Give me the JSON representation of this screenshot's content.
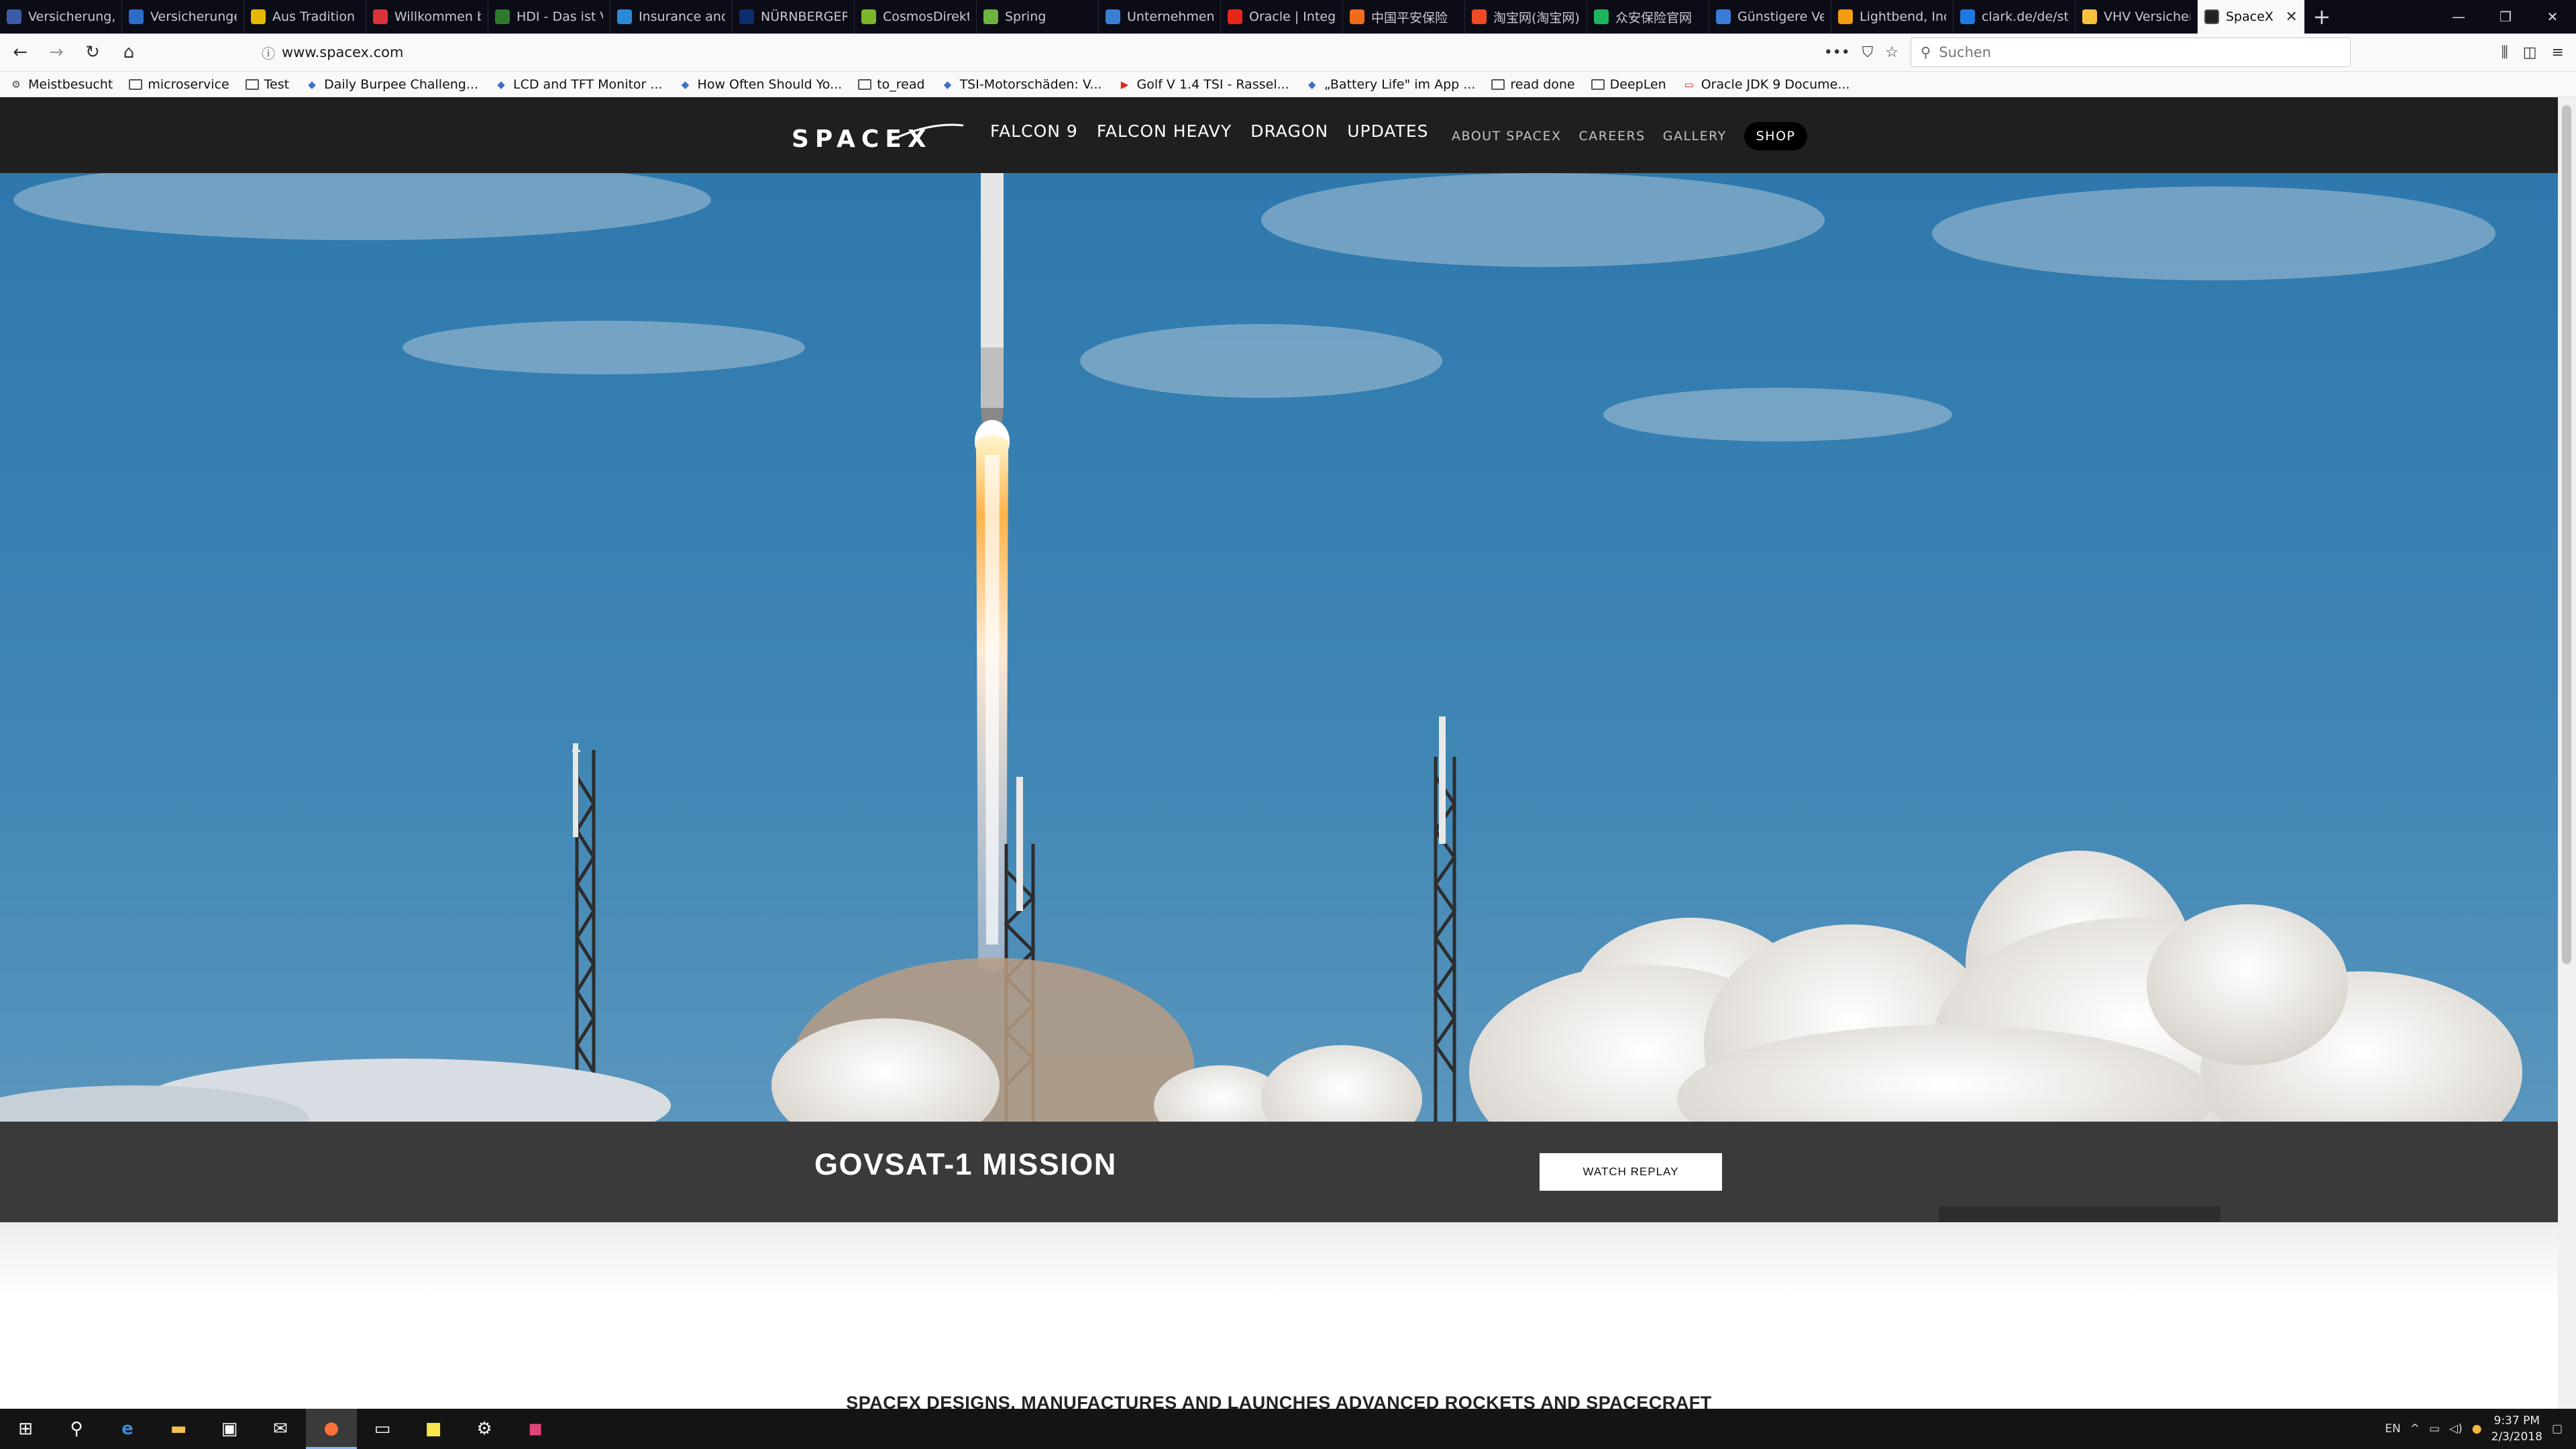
{
  "browser": {
    "tabs": [
      {
        "title": "Versicherung, V",
        "color": "#3b5ba9"
      },
      {
        "title": "Versicherungen",
        "color": "#2e6cc9"
      },
      {
        "title": "Aus Tradition g",
        "color": "#e6b800"
      },
      {
        "title": "Willkommen b",
        "color": "#d9343a"
      },
      {
        "title": "HDI - Das ist Vi",
        "color": "#2d7a2d"
      },
      {
        "title": "Insurance and",
        "color": "#2b8ad8"
      },
      {
        "title": "NÜRNBERGER",
        "color": "#0d2d6e"
      },
      {
        "title": "CosmosDirekt",
        "color": "#7bb62a"
      },
      {
        "title": "Spring",
        "color": "#6db33f"
      },
      {
        "title": "Unternehmens",
        "color": "#3b7fd4"
      },
      {
        "title": "Oracle | Integr",
        "color": "#e8271c"
      },
      {
        "title": "中国平安保险",
        "color": "#f26b1d"
      },
      {
        "title": "淘宝网(淘宝网)",
        "color": "#ee4b24"
      },
      {
        "title": "众安保险官网",
        "color": "#1fb45e"
      },
      {
        "title": "Günstigere Ve",
        "color": "#3a7bd5"
      },
      {
        "title": "Lightbend, Inc",
        "color": "#f39c12"
      },
      {
        "title": "clark.de/de/sta",
        "color": "#1f7ae0"
      },
      {
        "title": "VHV Versicher",
        "color": "#f6c23e"
      }
    ],
    "active_tab": "SpaceX",
    "new_tab_label": "+",
    "url": "www.spacex.com",
    "search_placeholder": "Suchen",
    "bookmarks": [
      {
        "label": "Meistbesucht",
        "icon": "gear-icon"
      },
      {
        "label": "microservice",
        "icon": "folder-icon"
      },
      {
        "label": "Test",
        "icon": "folder-icon"
      },
      {
        "label": "Daily Burpee Challeng...",
        "icon": "site-icon"
      },
      {
        "label": "LCD and TFT Monitor ...",
        "icon": "site-icon"
      },
      {
        "label": "How Often Should Yo...",
        "icon": "site-icon"
      },
      {
        "label": "to_read",
        "icon": "folder-icon"
      },
      {
        "label": "TSI-Motorschäden: V...",
        "icon": "site-icon"
      },
      {
        "label": "Golf V 1.4 TSI - Rassel...",
        "icon": "youtube-icon"
      },
      {
        "label": "„Battery Life\" im App ...",
        "icon": "site-icon"
      },
      {
        "label": "read done",
        "icon": "folder-icon"
      },
      {
        "label": "DeepLen",
        "icon": "folder-icon"
      },
      {
        "label": "Oracle JDK 9 Docume...",
        "icon": "oracle-icon"
      }
    ]
  },
  "site": {
    "logo_text": "SPACEX",
    "main_nav": [
      "FALCON 9",
      "FALCON HEAVY",
      "DRAGON",
      "UPDATES"
    ],
    "secondary_nav": [
      "ABOUT SPACEX",
      "CAREERS",
      "GALLERY"
    ],
    "shop_label": "SHOP",
    "mission_title": "GOVSAT-1 MISSION",
    "replay_button": "WATCH REPLAY",
    "tagline": "SPACEX DESIGNS, MANUFACTURES AND LAUNCHES ADVANCED ROCKETS AND SPACECRAFT"
  },
  "taskbar": {
    "language": "EN",
    "time": "9:37 PM",
    "date": "2/3/2018"
  },
  "colors": {
    "sky_top": "#2e78ad",
    "sky_bottom": "#4f8fb8",
    "nav_bg": "#1f1f1f",
    "mission_bg": "#3a3a3a",
    "tab_bg": "#0c0c17"
  }
}
